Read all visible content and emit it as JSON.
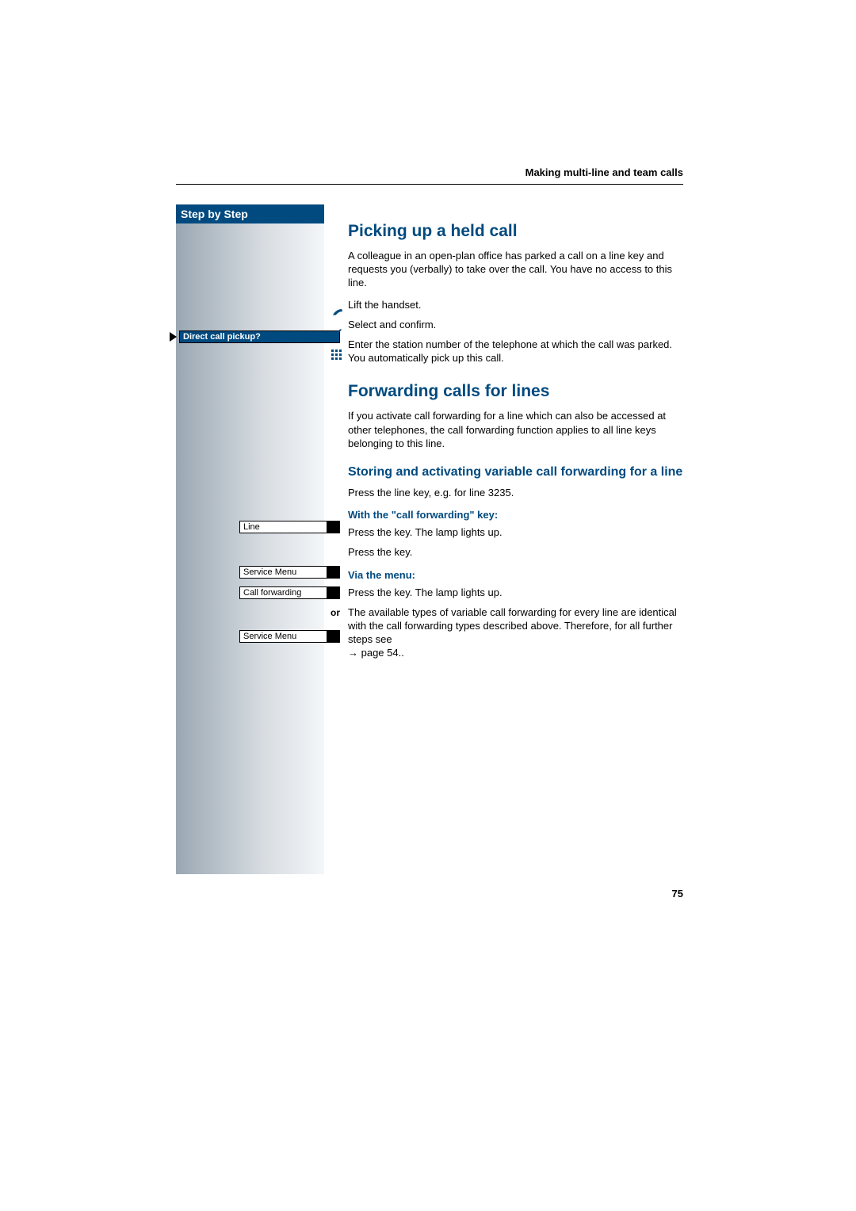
{
  "running_head": "Making multi-line and team calls",
  "page_number": "75",
  "sidebar": {
    "title": "Step by Step",
    "direct_pickup": "Direct call pickup?",
    "line": "Line",
    "service_menu_1": "Service Menu",
    "call_forwarding": "Call forwarding",
    "or_label": "or",
    "service_menu_2": "Service Menu"
  },
  "section1": {
    "title": "Picking up a held call",
    "intro": "A colleague in an open-plan office has parked a call on a line key and requests you (verbally) to take over the call. You have no access to this line.",
    "step_lift": "Lift the handset.",
    "step_confirm": "Select and confirm.",
    "step_enter": "Enter the station number of the telephone at which the call was parked. You automatically pick up this call."
  },
  "section2": {
    "title": "Forwarding calls for lines",
    "intro": "If you activate call forwarding for a line which can also be accessed at other telephones, the call forwarding function applies to all line keys belonging to this line.",
    "sub_title": "Storing and activating variable call forwarding for a line",
    "step_press_line": "Press the line key, e.g. for line 3235.",
    "with_key_heading": "With the \"call forwarding\" key:",
    "step_press_key_lamp1": "Press the key. The lamp lights up.",
    "step_press_key": "Press the key.",
    "via_menu_heading": "Via the menu:",
    "step_press_key_lamp2": "Press the key. The lamp lights up.",
    "tail_para_part1": "The available types of variable call forwarding for every line are identical with the call forwarding types described above. Therefore, for all further steps see ",
    "tail_para_pageref": "→ page 54.."
  }
}
